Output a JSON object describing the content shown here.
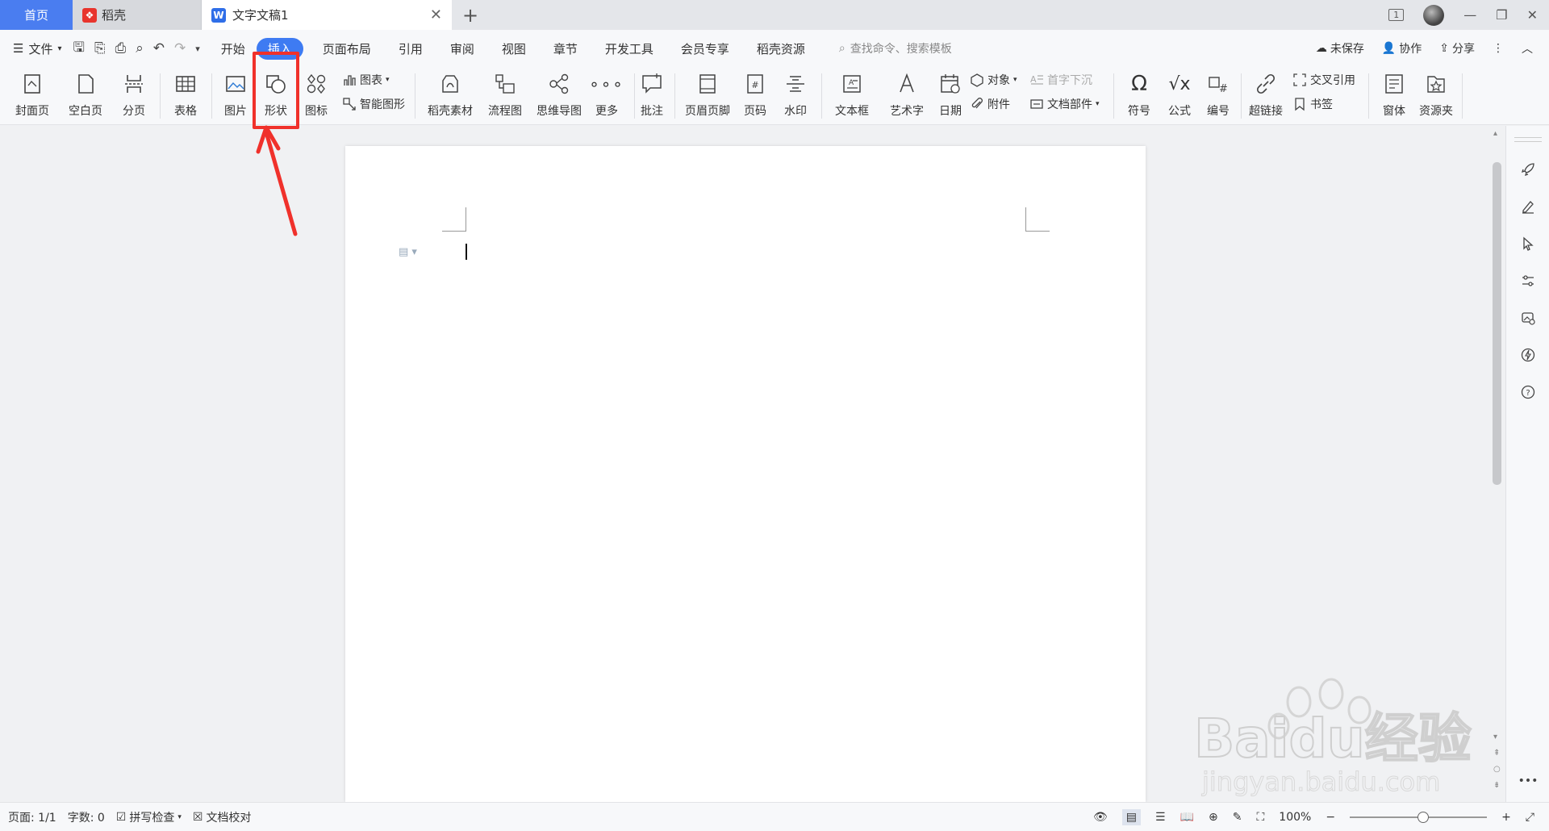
{
  "tabbar": {
    "home": "首页",
    "tabs": [
      {
        "label": "稻壳",
        "icon": "daoke-icon"
      },
      {
        "label": "文字文稿1",
        "icon": "wps-writer-icon"
      }
    ],
    "window_badge": "1"
  },
  "menu": {
    "file": "文件",
    "tabs": [
      "开始",
      "插入",
      "页面布局",
      "引用",
      "审阅",
      "视图",
      "章节",
      "开发工具",
      "会员专享",
      "稻壳资源"
    ],
    "active_tab": "插入",
    "search_placeholder": "查找命令、搜索模板",
    "unsaved": "未保存",
    "collab": "协作",
    "share": "分享"
  },
  "ribbon": {
    "cover": "封面页",
    "blank": "空白页",
    "pagebreak": "分页",
    "table": "表格",
    "picture": "图片",
    "shape": "形状",
    "icon": "图标",
    "chart": "图表",
    "smartart": "智能图形",
    "daoke_material": "稻壳素材",
    "flowchart": "流程图",
    "mindmap": "思维导图",
    "more": "更多",
    "comment": "批注",
    "header_footer": "页眉页脚",
    "page_number": "页码",
    "watermark": "水印",
    "textbox": "文本框",
    "wordart": "艺术字",
    "date": "日期",
    "object": "对象",
    "attachment": "附件",
    "dropcap": "首字下沉",
    "doc_parts": "文档部件",
    "symbol": "符号",
    "formula": "公式",
    "numbering": "编号",
    "hyperlink": "超链接",
    "crossref": "交叉引用",
    "bookmark": "书签",
    "form": "窗体",
    "resource": "资源夹"
  },
  "status": {
    "page": "页面: 1/1",
    "words": "字数: 0",
    "spellcheck": "拼写检查",
    "proofread": "文档校对",
    "zoom": "100%"
  },
  "watermark": {
    "brand": "Baidu经验",
    "url": "jingyan.baidu.com"
  },
  "colors": {
    "accent": "#3e7bf2",
    "annotation": "#f0312b"
  }
}
